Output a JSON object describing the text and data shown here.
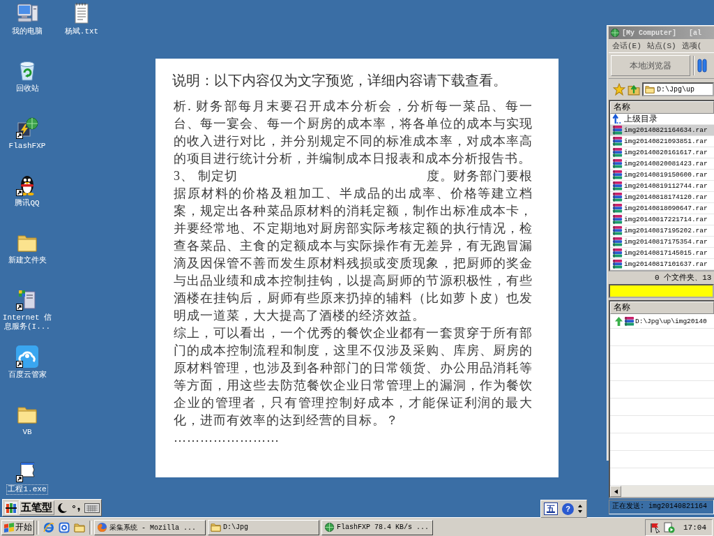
{
  "desktop": {
    "icons": [
      {
        "label": "我的电脑",
        "kind": "computer",
        "shortcut": false,
        "focused": false
      },
      {
        "label": "回收站",
        "kind": "recycle-bin",
        "shortcut": false,
        "focused": false
      },
      {
        "label": "FlashFXP",
        "kind": "ftp-app",
        "shortcut": true,
        "focused": false
      },
      {
        "label": "腾讯QQ",
        "kind": "penguin",
        "shortcut": true,
        "focused": false
      },
      {
        "label": "新建文件夹",
        "kind": "folder",
        "shortcut": false,
        "focused": false
      },
      {
        "label": "Internet 信息服务(I...",
        "kind": "server",
        "shortcut": true,
        "focused": false
      },
      {
        "label": "百度云管家",
        "kind": "cloud-app",
        "shortcut": true,
        "focused": false
      },
      {
        "label": "VB",
        "kind": "folder",
        "shortcut": false,
        "focused": false
      },
      {
        "label": "工程1.exe",
        "kind": "program",
        "shortcut": true,
        "focused": true
      },
      {
        "label": "杨斌.txt",
        "kind": "text-file",
        "shortcut": false,
        "focused": false
      }
    ]
  },
  "document": {
    "title": "说明：以下内容仅为文字预览，详细内容请下载查看。",
    "paragraphs": [
      {
        "kind": "paragraph",
        "text": "析. 财务部每月末要召开成本分析会，分析每一菜品、每一台、每一宴会、每一个厨房的成本率，将各单位的成本与实现的收入进行对比，并分别规定不同的标准成本率，对成本率高的项目进行统计分析，并编制成本日报表和成本分析报告书。"
      },
      {
        "kind": "split-line",
        "left": "3、 制定切",
        "right": "度。财务部门要根"
      },
      {
        "kind": "paragraph",
        "text": "据原材料的价格及粗加工、半成品的出成率、价格等建立档案，规定出各种菜品原材料的消耗定额，制作出标准成本卡，并要经常地、不定期地对厨房部实际考核定额的执行情况，检查各菜品、主食的定额成本与实际操作有无差异，有无跑冒漏滴及因保管不善而发生原材料残损或变质现象，把厨师的奖金与出品业绩和成本控制挂钩，以提高厨师的节源积极性，有些酒楼在挂钩后，厨师有些原来扔掉的辅料（比如萝卜皮）也发明成一道菜，大大提高了酒楼的经济效益。"
      },
      {
        "kind": "paragraph",
        "text": "综上，可以看出，一个优秀的餐饮企业都有一套贯穿于所有部门的成本控制流程和制度，这里不仅涉及采购、库房、厨房的原材料管理，也涉及到各种部门的日常领货、办公用品消耗等等方面，用这些去防范餐饮企业日常管理上的漏洞，作为餐饮企业的管理者，只有管理控制好成本，才能保证利润的最大化，进而有效率的达到经营的目标。？"
      },
      {
        "kind": "paragraph",
        "text": "……………………"
      }
    ]
  },
  "ftp": {
    "title": "[My Computer]   [al",
    "menu": [
      "会话(E)",
      "站点(S)",
      "选项("
    ],
    "toolbar_button": "本地浏览器",
    "path": "D:\\Jpg\\up",
    "list": {
      "column": "名称",
      "rows": [
        {
          "kind": "parent",
          "name": "上级目录",
          "selected": false
        },
        {
          "kind": "archive",
          "name": "img20140821164634.rar",
          "selected": true
        },
        {
          "kind": "archive",
          "name": "img20140821093851.rar",
          "selected": false
        },
        {
          "kind": "archive",
          "name": "img20140820161617.rar",
          "selected": false
        },
        {
          "kind": "archive",
          "name": "img20140820081423.rar",
          "selected": false
        },
        {
          "kind": "archive",
          "name": "img20140819150600.rar",
          "selected": false
        },
        {
          "kind": "archive",
          "name": "img20140819112744.rar",
          "selected": false
        },
        {
          "kind": "archive",
          "name": "img20140818174120.rar",
          "selected": false
        },
        {
          "kind": "archive",
          "name": "img20140818090647.rar",
          "selected": false
        },
        {
          "kind": "archive",
          "name": "img20140817221714.rar",
          "selected": false
        },
        {
          "kind": "archive",
          "name": "img20140817195202.rar",
          "selected": false
        },
        {
          "kind": "archive",
          "name": "img20140817175354.rar",
          "selected": false
        },
        {
          "kind": "archive",
          "name": "img20140817145015.rar",
          "selected": false
        },
        {
          "kind": "archive",
          "name": "img20140817101637.rar",
          "selected": false
        }
      ]
    },
    "summary": "0 个文件夹、13",
    "queue": {
      "column": "名称",
      "rows": [
        {
          "kind": "upload",
          "name": "D:\\Jpg\\up\\img20140"
        }
      ]
    },
    "status": "正在发送: img20140821164"
  },
  "ime_bar": {
    "mode": "五笔型"
  },
  "language_bar": {
    "indicator": "五",
    "help": "?"
  },
  "taskbar": {
    "start": "开始",
    "quick_launch": [
      {
        "kind": "browser"
      },
      {
        "kind": "page"
      },
      {
        "kind": "folder"
      }
    ],
    "tasks": [
      {
        "kind": "browser",
        "label": "采集系统 - Mozilla ...",
        "selected": false
      },
      {
        "kind": "folder",
        "label": "D:\\Jpg",
        "selected": false
      },
      {
        "kind": "globe",
        "label": "FlashFXP 78.4 KB/s ...",
        "selected": false
      }
    ],
    "clock": "17:04"
  }
}
